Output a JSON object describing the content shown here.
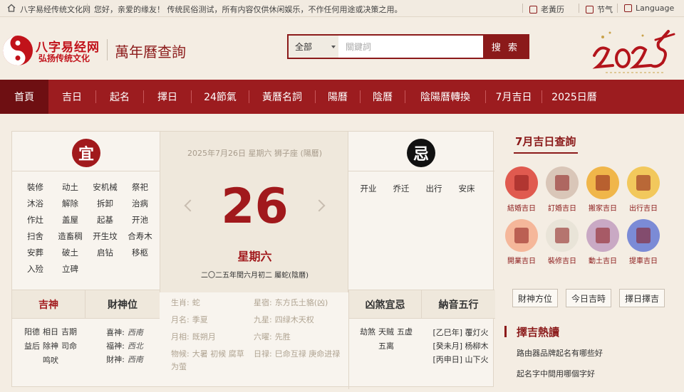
{
  "topbar": {
    "site_name": "八字易经传统文化网",
    "greeting": "您好，亲爱的缘友！ 传统民俗测试，所有内容仅供休闲娱乐，不作任何用途或决策之用。",
    "links": [
      "老黃历",
      "节气",
      "Language"
    ]
  },
  "header": {
    "logo_name": "八字易经网",
    "logo_sub": "弘扬传统文化",
    "page_title": "萬年曆查詢",
    "search": {
      "select_value": "全部",
      "placeholder": "關鍵詞",
      "button": "搜 索"
    },
    "year_art": "2025"
  },
  "nav": [
    "首頁",
    "吉日",
    "起名",
    "擇日",
    "24節氣",
    "黃曆名詞",
    "陽曆",
    "陰曆",
    "陰陽曆轉換",
    "7月吉日",
    "2025日曆"
  ],
  "yi": {
    "badge": "宜",
    "items": [
      "裝修",
      "动土",
      "安机械",
      "祭祀",
      "沐浴",
      "解除",
      "拆卸",
      "治病",
      "作灶",
      "盖屋",
      "起基",
      "开池",
      "扫舍",
      "造畜稠",
      "开生坟",
      "合寿木",
      "安葬",
      "破土",
      "启钻",
      "移柩",
      "入殓",
      "立碑"
    ]
  },
  "ji": {
    "badge": "忌",
    "items": [
      "开业",
      "乔迁",
      "出行",
      "安床"
    ]
  },
  "date": {
    "line": "2025年7月26日  星期六  狮子座 (陽曆)",
    "day": "26",
    "weekday": "星期六",
    "lunar": "二〇二五年閏六月初二  屬蛇(陰曆)"
  },
  "lower": {
    "jishen_title": "吉神",
    "jishen_items": [
      "阳德",
      "相日",
      "吉期",
      "益后",
      "除神",
      "司命",
      "鸣吠"
    ],
    "caishen_title": "財神位",
    "caishen_items": [
      {
        "label": "喜神:",
        "value": "西南"
      },
      {
        "label": "福神:",
        "value": "西北"
      },
      {
        "label": "財神:",
        "value": "西南"
      }
    ],
    "center_rows": [
      {
        "k1": "生肖:",
        "v1": "蛇",
        "k2": "星宿:",
        "v2": "东方氐土貉(凶)"
      },
      {
        "k1": "月名:",
        "v1": "季夏",
        "k2": "九星:",
        "v2": "四绿木天权"
      },
      {
        "k1": "月相:",
        "v1": "既朔月",
        "k2": "六曜:",
        "v2": "先胜"
      },
      {
        "k1": "物候:",
        "v1": "大暑 初候 腐草为萤",
        "k2": "日禄:",
        "v2": "巳命互禄 庚命进禄"
      }
    ],
    "xiongsha_title": "凶煞宜忌",
    "xiongsha_items": [
      "劫煞",
      "天贼",
      "五虚",
      "五离"
    ],
    "nayin_title": "納音五行",
    "nayin_items": [
      "[乙巳年]  覆灯火",
      "[癸未月]  杨柳木",
      "[丙申日]  山下火"
    ]
  },
  "sidebar": {
    "title": "7月吉日查詢",
    "jiri": [
      {
        "label": "結婚吉日",
        "icon": "wedding-icon",
        "color": "#e05a4f"
      },
      {
        "label": "訂婚吉日",
        "icon": "gift-icon",
        "color": "#d9c6b8"
      },
      {
        "label": "搬家吉日",
        "icon": "moving-icon",
        "color": "#f0b64a"
      },
      {
        "label": "出行吉日",
        "icon": "horse-icon",
        "color": "#f2c85c"
      },
      {
        "label": "開業吉日",
        "icon": "drum-icon",
        "color": "#f5b79a"
      },
      {
        "label": "裝修吉日",
        "icon": "painting-icon",
        "color": "#e9e4d8"
      },
      {
        "label": "動土吉日",
        "icon": "shovel-icon",
        "color": "#c9a9c4"
      },
      {
        "label": "提車吉日",
        "icon": "lantern-icon",
        "color": "#7b8bd6"
      }
    ],
    "buttons": [
      "財神方位",
      "今日吉時",
      "擇日擇吉"
    ],
    "hot_title": "擇吉熱讀",
    "hot_items": [
      "路由器品牌起名有哪些好",
      "起名字中間用哪個字好"
    ]
  }
}
